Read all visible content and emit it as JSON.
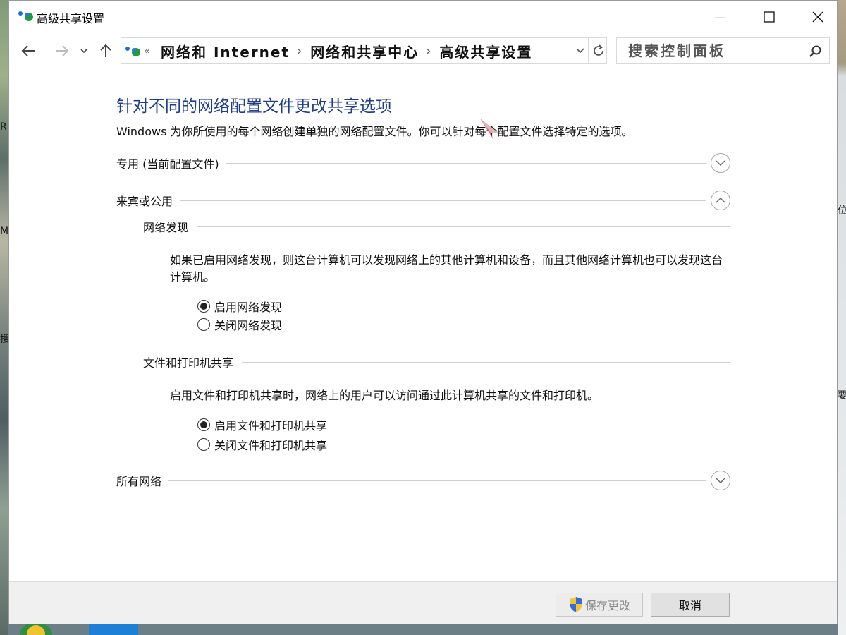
{
  "window": {
    "title": "高级共享设置",
    "minimize_glyph": "—",
    "maximize_glyph": "☐",
    "close_glyph": "✕"
  },
  "nav": {
    "address_prefix": "«",
    "breadcrumbs": [
      "网络和 Internet",
      "网络和共享中心",
      "高级共享设置"
    ],
    "separator": "›",
    "search_placeholder": "搜索控制面板"
  },
  "main": {
    "title": "针对不同的网络配置文件更改共享选项",
    "description": "Windows 为你所使用的每个网络创建单独的网络配置文件。你可以针对每个配置文件选择特定的选项。",
    "profiles": {
      "private": {
        "label": "专用 (当前配置文件)",
        "expanded": false
      },
      "guest": {
        "label": "来宾或公用",
        "expanded": true,
        "network_discovery": {
          "heading": "网络发现",
          "description": "如果已启用网络发现，则这台计算机可以发现网络上的其他计算机和设备，而且其他网络计算机也可以发现这台计算机。",
          "options": [
            {
              "label": "启用网络发现",
              "selected": true
            },
            {
              "label": "关闭网络发现",
              "selected": false
            }
          ]
        },
        "file_sharing": {
          "heading": "文件和打印机共享",
          "description": "启用文件和打印机共享时，网络上的用户可以访问通过此计算机共享的文件和打印机。",
          "options": [
            {
              "label": "启用文件和打印机共享",
              "selected": true
            },
            {
              "label": "关闭文件和打印机共享",
              "selected": false
            }
          ]
        }
      },
      "all": {
        "label": "所有网络",
        "expanded": false
      }
    }
  },
  "footer": {
    "save_label": "保存更改",
    "cancel_label": "取消"
  },
  "desktop": {
    "left_glyphs": [
      "R",
      "M",
      "搜"
    ],
    "right_glyphs": [
      "位",
      "要"
    ]
  },
  "colors": {
    "title_blue": "#1e3e87",
    "footer_bg": "#f0f0f0"
  }
}
